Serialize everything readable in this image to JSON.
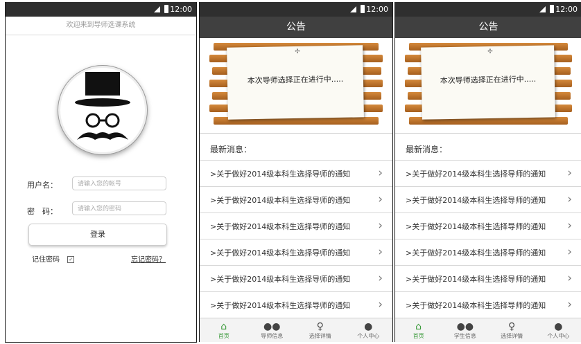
{
  "status_bar": {
    "time": "12:00"
  },
  "login": {
    "welcome": "欢迎来到导师选课系统",
    "username_label": "用户名：",
    "username_placeholder": "请输入您的帐号",
    "password_label": "密　码：",
    "password_placeholder": "请输入您的密码",
    "login_button": "登录",
    "remember_label": "记住密码",
    "remember_checked": true,
    "forgot_link": "忘记密码？"
  },
  "notice": {
    "title": "公告",
    "banner_text": "本次导师选择正在进行中.....",
    "news_header": "最新消息：",
    "news_items": [
      ">关于做好2014级本科生选择导师的通知",
      ">关于做好2014级本科生选择导师的通知",
      ">关于做好2014级本科生选择导师的通知",
      ">关于做好2014级本科生选择导师的通知",
      ">关于做好2014级本科生选择导师的通知",
      ">关于做好2014级本科生选择导师的通知"
    ],
    "arrow": "›"
  },
  "tabs_screen2": [
    "首页",
    "导师信息",
    "选择详情",
    "个人中心"
  ],
  "tabs_screen3": [
    "首页",
    "学生信息",
    "选择详情",
    "个人中心"
  ],
  "tab_icons": [
    "home-icon",
    "people-icon",
    "lightbulb-icon",
    "person-icon"
  ],
  "colors": {
    "status_bar": "#2f2f2f",
    "title_bar": "#404040",
    "active_tab": "#3a9a3a",
    "wood": "#c27a35"
  }
}
